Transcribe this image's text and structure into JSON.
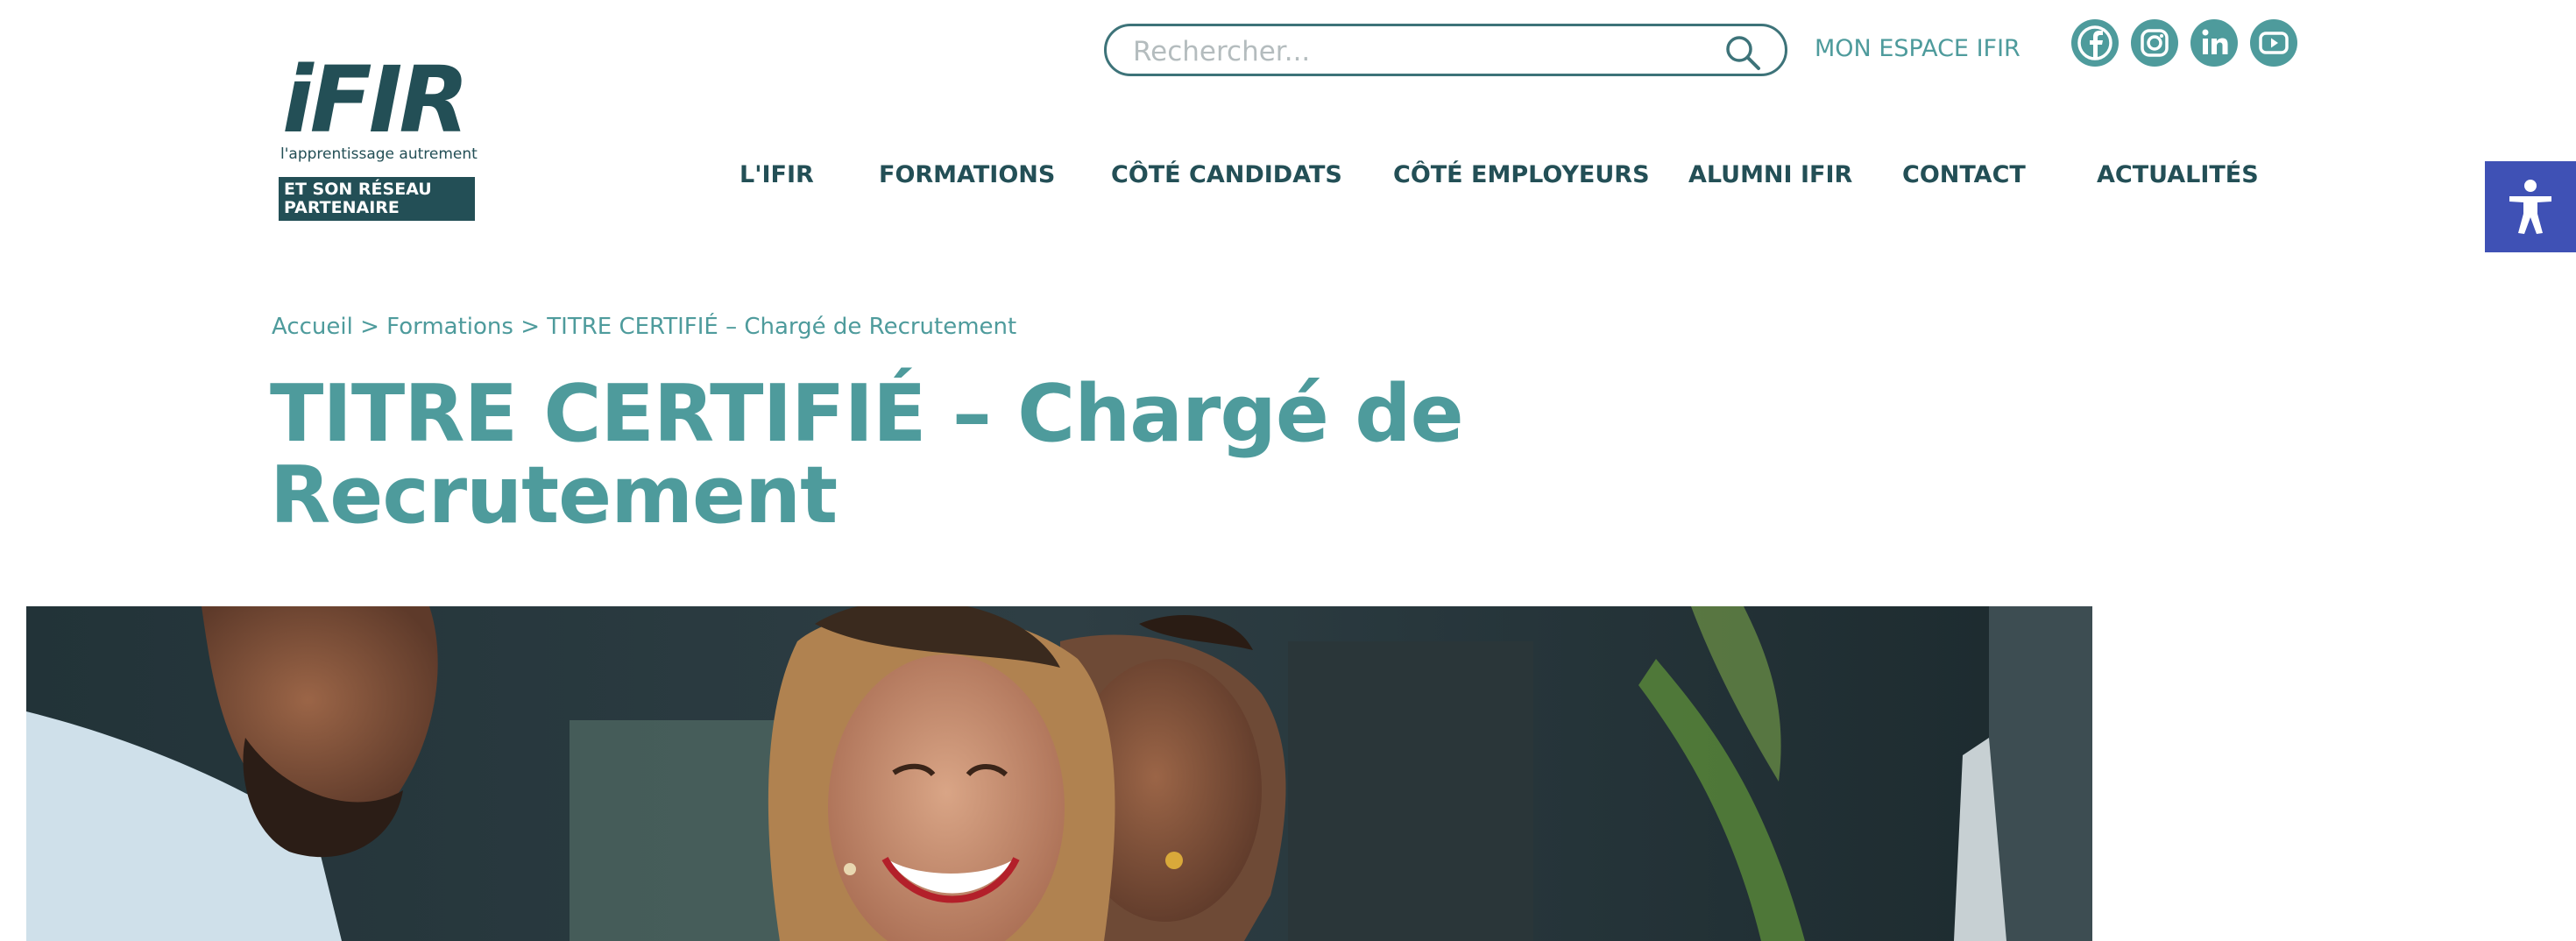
{
  "logo": {
    "wordmark": "iFIR",
    "tagline": "l'apprentissage autrement",
    "badge_line1": "ET SON RÉSEAU",
    "badge_line2": "PARTENAIRE"
  },
  "search": {
    "placeholder": "Rechercher..."
  },
  "header": {
    "espace_label": "MON ESPACE IFIR"
  },
  "social": [
    "facebook-icon",
    "instagram-icon",
    "linkedin-icon",
    "youtube-icon"
  ],
  "nav": {
    "items": [
      "L'IFIR",
      "FORMATIONS",
      "CÔTÉ CANDIDATS",
      "CÔTÉ EMPLOYEURS",
      "ALUMNI IFIR",
      "CONTACT",
      "ACTUALITÉS"
    ]
  },
  "breadcrumb": {
    "home": "Accueil",
    "separator": ">",
    "section": "Formations",
    "current": "TITRE CERTIFIÉ – Chargé de Recrutement"
  },
  "page": {
    "title_line1": "TITRE CERTIFIÉ – Chargé de",
    "title_line2": "Recrutement"
  },
  "colors": {
    "brand_dark": "#234f56",
    "brand_teal": "#4e9b9c",
    "accessibility": "#3f51b5"
  }
}
